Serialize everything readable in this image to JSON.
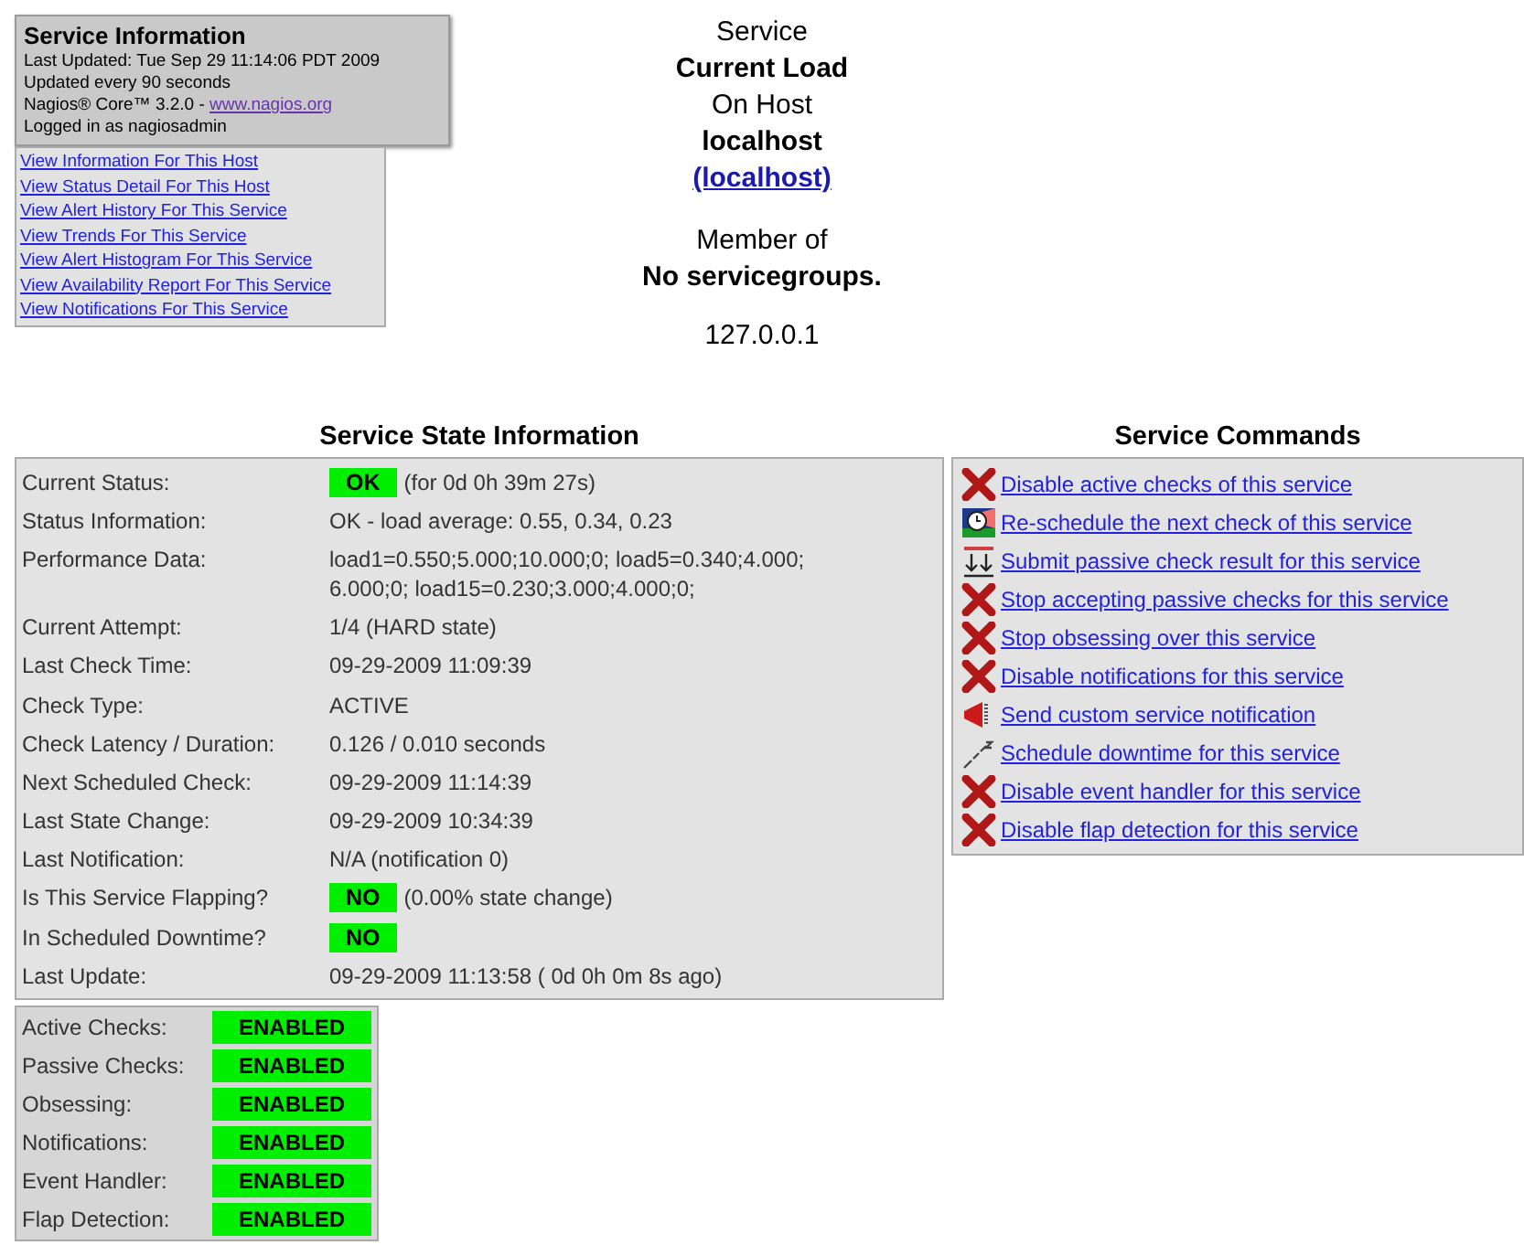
{
  "info_box": {
    "title": "Service Information",
    "lines": [
      "Last Updated: Tue Sep 29 11:14:06 PDT 2009",
      "Updated every 90 seconds"
    ],
    "version": "Nagios® Core™ 3.2.0 - ",
    "version_link": "www.nagios.org",
    "logged_in": "Logged in as nagiosadmin"
  },
  "links": [
    "View Information For This Host",
    "View Status Detail For This Host",
    "View Alert History For This Service",
    "View Trends For This Service",
    "View Alert Histogram For This Service",
    "View Availability Report For This Service",
    "View Notifications For This Service"
  ],
  "header": {
    "service_label": "Service",
    "service_name": "Current Load",
    "host_label": "On Host",
    "host_name": "localhost",
    "host_link": "(localhost)",
    "member_label": "Member of",
    "groups": "No servicegroups.",
    "address": "127.0.0.1"
  },
  "state_info": {
    "title": "Service State Information",
    "rows": [
      {
        "label": "Current Status:",
        "badge": {
          "text": "OK",
          "ok": true
        },
        "value": "(for 0d 0h 39m 27s)"
      },
      {
        "label": "Status Information:",
        "value": "OK - load average: 0.55, 0.34, 0.23"
      },
      {
        "label": "Performance Data:",
        "value": "load1=0.550;5.000;10.000;0; load5=0.340;4.000; 6.000;0; load15=0.230;3.000;4.000;0;"
      },
      {
        "label": "Current Attempt:",
        "value": "1/4  (HARD state)"
      },
      {
        "label": "Last Check Time:",
        "value": "09-29-2009 11:09:39"
      },
      {
        "label": "Check Type:",
        "value": "ACTIVE"
      },
      {
        "label": "Check Latency / Duration:",
        "value": "0.126 / 0.010 seconds"
      },
      {
        "label": "Next Scheduled Check:",
        "value": "09-29-2009 11:14:39"
      },
      {
        "label": "Last State Change:",
        "value": "09-29-2009 10:34:39"
      },
      {
        "label": "Last Notification:",
        "value": "N/A (notification 0)"
      },
      {
        "label": "Is This Service Flapping?",
        "badge": {
          "text": "NO",
          "ok": true
        },
        "value": "(0.00% state change)"
      },
      {
        "label": "In Scheduled Downtime?",
        "badge": {
          "text": "NO",
          "ok": true
        }
      },
      {
        "label": "Last Update:",
        "value": "09-29-2009 11:13:58  ( 0d 0h 0m 8s ago)"
      }
    ]
  },
  "features": [
    {
      "label": "Active Checks:",
      "status": "ENABLED",
      "enabled": true
    },
    {
      "label": "Passive Checks:",
      "status": "ENABLED",
      "enabled": true
    },
    {
      "label": "Obsessing:",
      "status": "ENABLED",
      "enabled": true
    },
    {
      "label": "Notifications:",
      "status": "ENABLED",
      "enabled": true
    },
    {
      "label": "Event Handler:",
      "status": "ENABLED",
      "enabled": true
    },
    {
      "label": "Flap Detection:",
      "status": "ENABLED",
      "enabled": true
    }
  ],
  "commands": {
    "title": "Service Commands",
    "items": [
      {
        "kind": "cross",
        "label": "Disable active checks of this service"
      },
      {
        "kind": "clock",
        "label": "Re-schedule the next check of this service"
      },
      {
        "kind": "passive",
        "label": "Submit passive check result for this service"
      },
      {
        "kind": "cross",
        "label": "Stop accepting passive checks for this service"
      },
      {
        "kind": "cross",
        "label": "Stop obsessing over this service"
      },
      {
        "kind": "cross",
        "label": "Disable notifications for this service"
      },
      {
        "kind": "megaphone",
        "label": "Send custom service notification"
      },
      {
        "kind": "zzz",
        "label": "Schedule downtime for this service"
      },
      {
        "kind": "cross",
        "label": "Disable event handler for this service"
      },
      {
        "kind": "cross",
        "label": "Disable flap detection for this service"
      }
    ]
  }
}
